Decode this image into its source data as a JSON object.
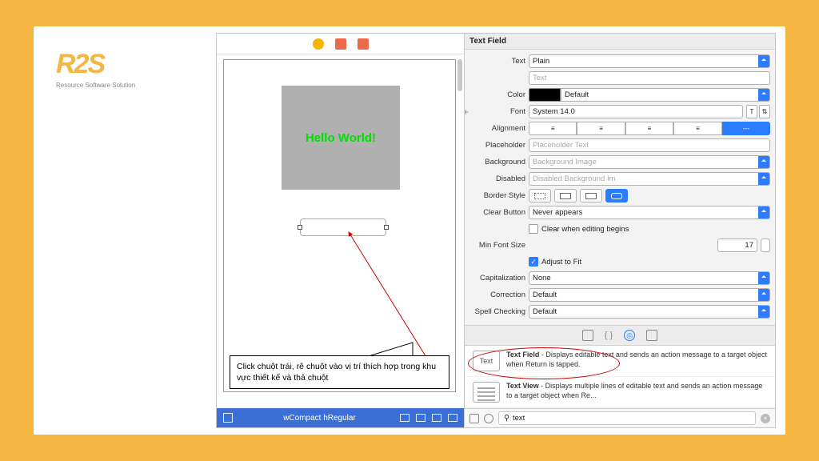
{
  "logo": {
    "mark": "R2S",
    "tagline": "Resource Software Solution"
  },
  "canvas": {
    "hello_text": "Hello World!",
    "callout_text": "Click chuột trái, rê chuột vào vị trí thích hợp trong khu vực thiết kế và thả chuột",
    "size_label": "wCompact hRegular"
  },
  "inspector": {
    "title": "Text Field",
    "text": {
      "label": "Text",
      "value": "Plain",
      "placeholder": "Text"
    },
    "color": {
      "label": "Color",
      "value": "Default"
    },
    "font": {
      "label": "Font",
      "value": "System 14.0"
    },
    "alignment": {
      "label": "Alignment"
    },
    "placeholder": {
      "label": "Placeholder",
      "hint": "Placeholder Text"
    },
    "background": {
      "label": "Background",
      "hint": "Background Image"
    },
    "disabled": {
      "label": "Disabled",
      "hint": "Disabled Background Im"
    },
    "border_style": {
      "label": "Border Style"
    },
    "clear_button": {
      "label": "Clear Button",
      "value": "Never appears",
      "checkbox_label": "Clear when editing begins"
    },
    "min_font": {
      "label": "Min Font Size",
      "value": "17",
      "adjust_label": "Adjust to Fit"
    },
    "capitalization": {
      "label": "Capitalization",
      "value": "None"
    },
    "correction": {
      "label": "Correction",
      "value": "Default"
    },
    "spell": {
      "label": "Spell Checking",
      "value": "Default"
    }
  },
  "library": {
    "items": [
      {
        "icon": "Text",
        "title": "Text Field",
        "desc": " - Displays editable text and sends an action message to a target object when Return is tapped."
      },
      {
        "icon": "lines",
        "title": "Text View",
        "desc": " - Displays multiple lines of editable text and sends an action message to a target object when Re..."
      }
    ],
    "search_value": "text"
  }
}
